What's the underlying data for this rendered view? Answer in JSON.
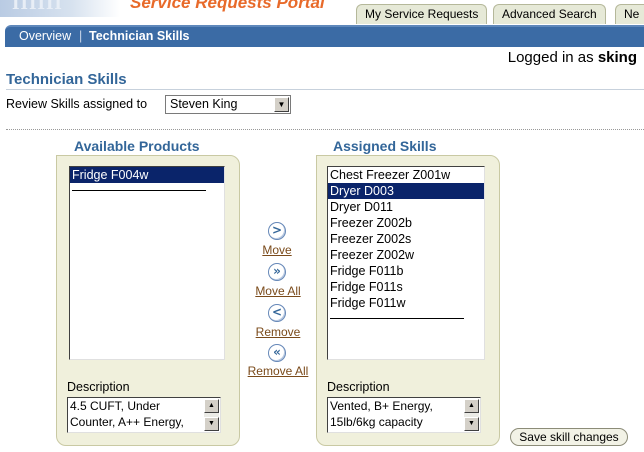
{
  "header": {
    "brand_text": "IIIIII",
    "portal_title": "Service Requests Portal",
    "tabs": [
      {
        "label": "My Service Requests"
      },
      {
        "label": "Advanced Search"
      },
      {
        "label": "Ne"
      }
    ]
  },
  "subnav": {
    "overview": "Overview",
    "separator": "|",
    "current": "Technician Skills"
  },
  "login": {
    "prefix": "Logged in as",
    "user": "sking"
  },
  "page": {
    "title": "Technician Skills",
    "review_label": "Review Skills assigned to",
    "selected_technician": "Steven King"
  },
  "available": {
    "title": "Available Products",
    "items": [
      "Fridge F004w"
    ],
    "selected_index": 0,
    "description_label": "Description",
    "description": "4.5 CUFT, Under\nCounter, A++ Energy,"
  },
  "moves": {
    "move": "Move",
    "move_all": "Move All",
    "remove": "Remove",
    "remove_all": "Remove All",
    "move_icon": ">",
    "move_all_icon": "»",
    "remove_icon": "<",
    "remove_all_icon": "«"
  },
  "assigned": {
    "title": "Assigned Skills",
    "items": [
      "Chest Freezer Z001w",
      "Dryer D003",
      "Dryer D011",
      "Freezer Z002b",
      "Freezer Z002s",
      "Freezer Z002w",
      "Fridge F011b",
      "Fridge F011s",
      "Fridge F011w"
    ],
    "selected_index": 1,
    "description_label": "Description",
    "description": "Vented, B+ Energy,\n15lb/6kg capacity"
  },
  "actions": {
    "save": "Save skill changes"
  },
  "colors": {
    "nav_bar": "#3b6ba5",
    "heading": "#336699",
    "selection": "#0a246a",
    "portal_title": "#e86a2a",
    "panel_bg": "#f0f0dc"
  }
}
